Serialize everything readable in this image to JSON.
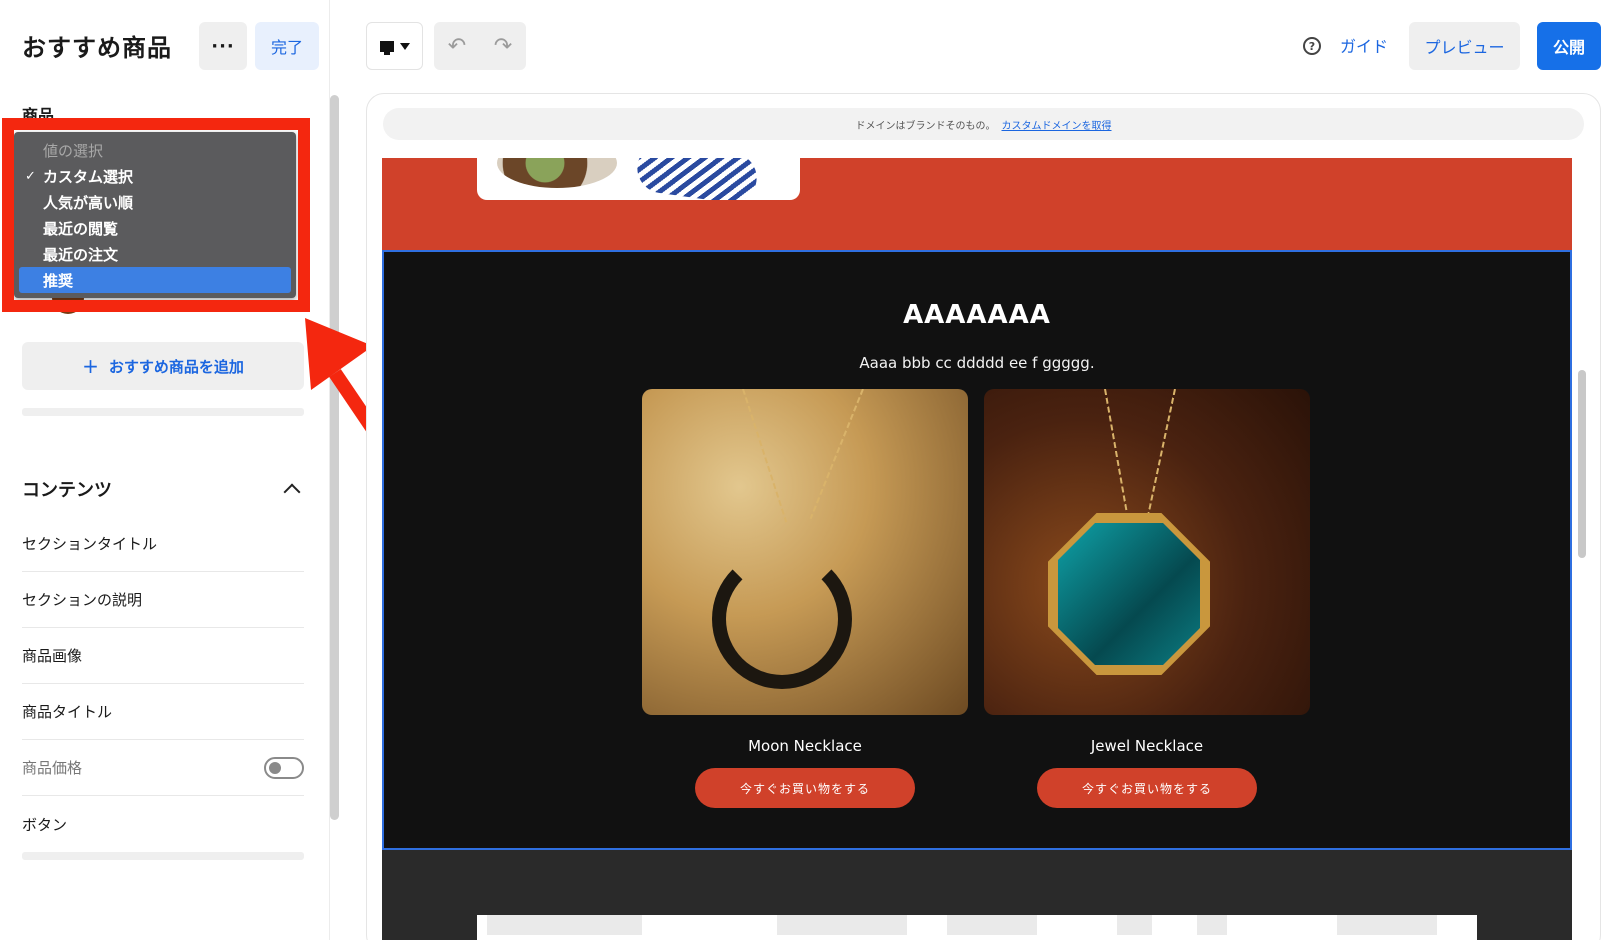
{
  "panel": {
    "title": "おすすめ商品",
    "more_label": "···",
    "done_label": "完了",
    "section_label": "商品",
    "add_button_label": "おすすめ商品を追加",
    "add_button_icon": "plus-icon"
  },
  "dropdown": {
    "placeholder": "値の選択",
    "items": [
      {
        "label": "カスタム選択",
        "checked": true
      },
      {
        "label": "人気が高い順",
        "checked": false
      },
      {
        "label": "最近の閲覧",
        "checked": false
      },
      {
        "label": "最近の注文",
        "checked": false
      },
      {
        "label": "推奨",
        "highlighted": true
      }
    ],
    "check_mark": "✓"
  },
  "contents": {
    "heading": "コンテンツ",
    "rows": [
      {
        "label": "セクションタイトル"
      },
      {
        "label": "セクションの説明"
      },
      {
        "label": "商品画像"
      },
      {
        "label": "商品タイトル"
      },
      {
        "label": "商品価格",
        "toggle": "off"
      },
      {
        "label": "ボタン"
      }
    ]
  },
  "toolbar": {
    "undo_icon": "undo-icon",
    "redo_icon": "redo-icon",
    "help_label": "?",
    "guide_label": "ガイド",
    "preview_label": "プレビュー",
    "publish_label": "公開"
  },
  "canvas": {
    "domain_text": "ドメインはブランドそのもの。",
    "domain_link": "カスタムドメインを取得",
    "section_title": "AAAAAAA",
    "section_desc": "Aaaa bbb cc ddddd ee f ggggg.",
    "products": [
      {
        "name": "Moon Necklace",
        "button": "今すぐお買い物をする"
      },
      {
        "name": "Jewel Necklace",
        "button": "今すぐお買い物をする"
      }
    ]
  },
  "colors": {
    "accent_blue": "#1b66e0",
    "publish_bg": "#1670e8",
    "brand_red": "#d0412a",
    "annotation_red": "#f4270f",
    "section_bg": "#111111"
  }
}
